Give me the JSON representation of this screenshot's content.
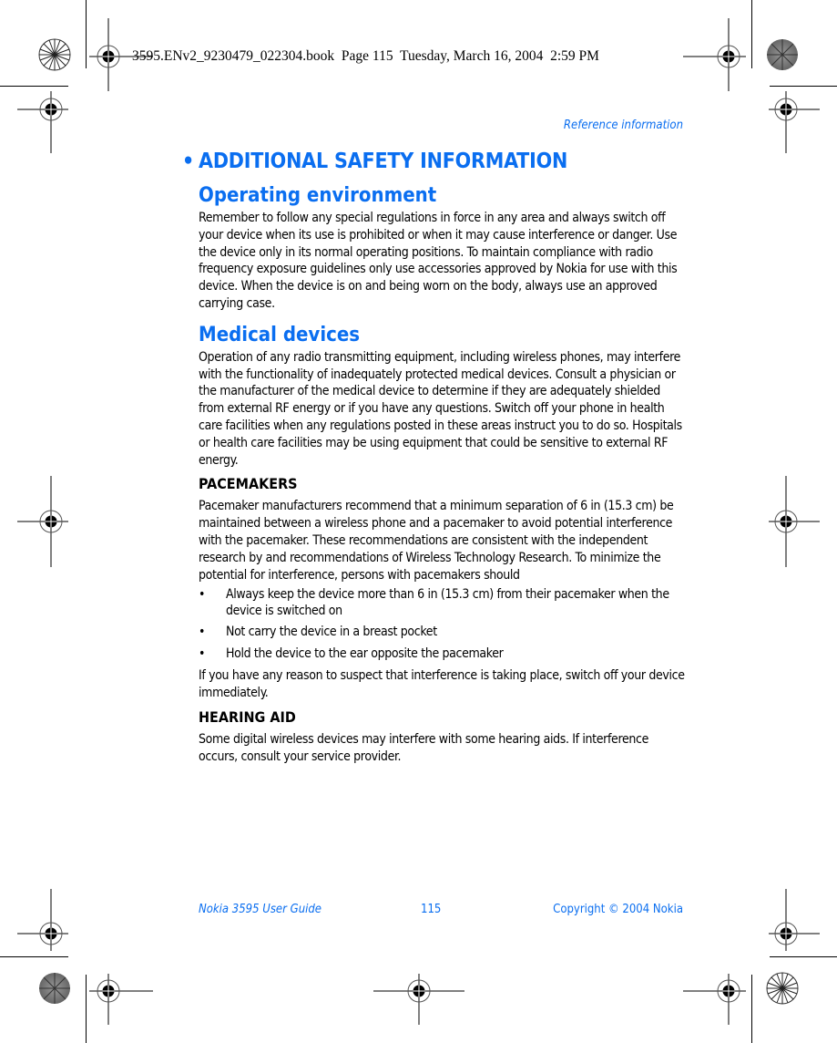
{
  "slug": "3595.ENv2_9230479_022304.book  Page 115  Tuesday, March 16, 2004  2:59 PM",
  "running_head": "Reference information",
  "colors": {
    "accent": "#0a6ef0",
    "text": "#000000"
  },
  "section": {
    "bullet": "•",
    "title": "ADDITIONAL SAFETY INFORMATION"
  },
  "operating_environment": {
    "heading": "Operating environment",
    "body": "Remember to follow any special regulations in force in any area and always switch off your device when its use is prohibited or when it may cause interference or danger. Use the device only in its normal operating positions. To maintain compliance with radio frequency exposure guidelines only use accessories approved by Nokia for use with this device. When the device is on and being worn on the body, always use an approved carrying case."
  },
  "medical_devices": {
    "heading": "Medical devices",
    "body": "Operation of any radio transmitting equipment, including wireless phones, may interfere with the functionality of inadequately protected medical devices. Consult a physician or the manufacturer of the medical device to determine if they are adequately shielded from external RF energy or if you have any questions. Switch off your phone in health care facilities when any regulations posted in these areas instruct you to do so. Hospitals or health care facilities may be using equipment that could be sensitive to external RF energy."
  },
  "pacemakers": {
    "heading": "PACEMAKERS",
    "body": "Pacemaker manufacturers recommend that a minimum separation of 6 in (15.3 cm) be maintained between a wireless phone and a pacemaker to avoid potential interference with the pacemaker. These recommendations are consistent with the independent research by and recommendations of Wireless Technology Research. To minimize the potential for interference, persons with pacemakers should",
    "bullet_glyph": "•",
    "items": [
      "Always keep the device more than 6 in (15.3 cm) from their pacemaker when the device is switched on",
      "Not carry the device in a breast pocket",
      "Hold the device to the ear opposite the pacemaker"
    ],
    "closing": "If you have any reason to suspect that interference is taking place, switch off your device immediately."
  },
  "hearing_aid": {
    "heading": "HEARING AID",
    "body": "Some digital wireless devices may interfere with some hearing aids. If interference occurs, consult your service provider."
  },
  "footer": {
    "guide": "Nokia 3595 User Guide",
    "page": "115",
    "copyright": "Copyright © 2004 Nokia"
  }
}
